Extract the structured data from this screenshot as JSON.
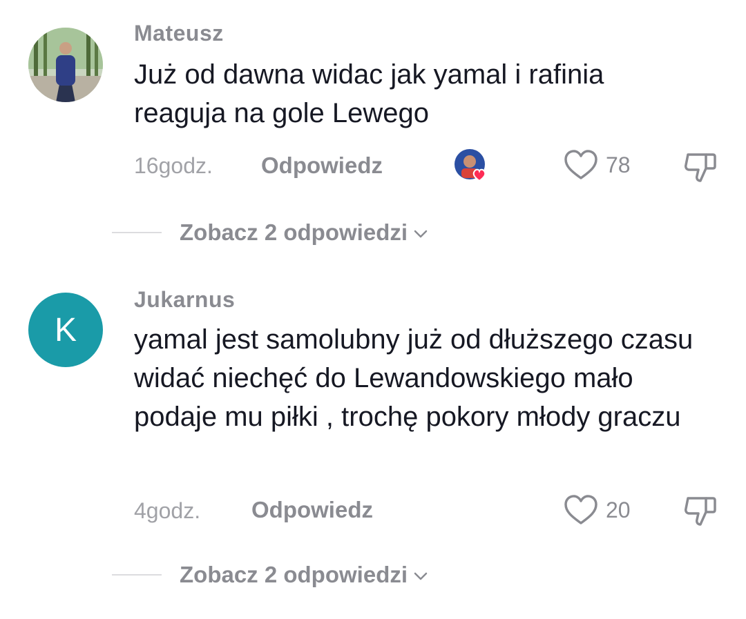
{
  "comments": [
    {
      "username": "Mateusz",
      "text": "Już od dawna widac jak yamal i rafinia reaguja na gole Lewego",
      "time": "16godz.",
      "reply_label": "Odpowiedz",
      "likes": "78",
      "view_replies": "Zobacz 2 odpowiedzi",
      "avatar_icon": "photo-avatar",
      "creator_liked": true
    },
    {
      "username": "Jukarnus",
      "text": "yamal jest samolubny już od dłuższego czasu widać niechęć do Lewandowskiego mało podaje mu piłki , trochę pokory młody graczu",
      "time": "4godz.",
      "reply_label": "Odpowiedz",
      "likes": "20",
      "view_replies": "Zobacz 2 odpowiedzi",
      "avatar_letter": "K",
      "avatar_color": "#1a9ba8"
    }
  ],
  "colors": {
    "text": "#161823",
    "muted": "#8a8b91",
    "timestamp": "#a1a2a7",
    "heart_badge": "#fe2c55"
  }
}
